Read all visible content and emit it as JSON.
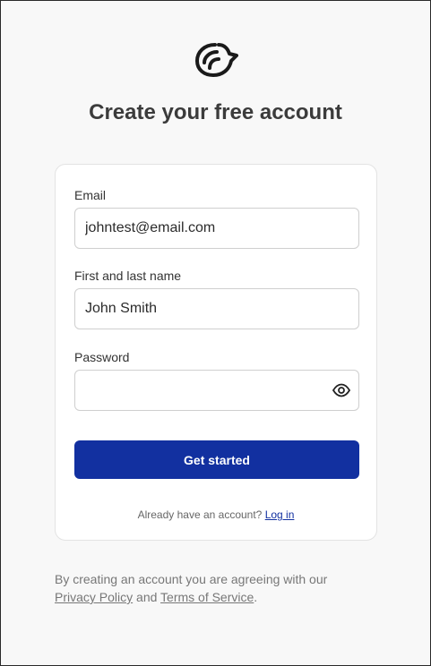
{
  "logo": {
    "icon": "bird-logo-icon"
  },
  "title": "Create your free account",
  "form": {
    "email_label": "Email",
    "email_value": "johntest@email.com",
    "name_label": "First and last name",
    "name_value": "John Smith",
    "password_label": "Password",
    "password_value": "",
    "password_icon": "eye-icon",
    "submit_label": "Get started",
    "login_prompt": "Already have an account?",
    "login_link": "Log in"
  },
  "footer": {
    "text_before": "By creating an account you are agreeing with our",
    "privacy_link": "Privacy Policy",
    "and_text": "and",
    "terms_link": "Terms of Service",
    "period": "."
  },
  "colors": {
    "primary": "#1230a0",
    "background": "#f8f8f8",
    "card": "#ffffff"
  }
}
